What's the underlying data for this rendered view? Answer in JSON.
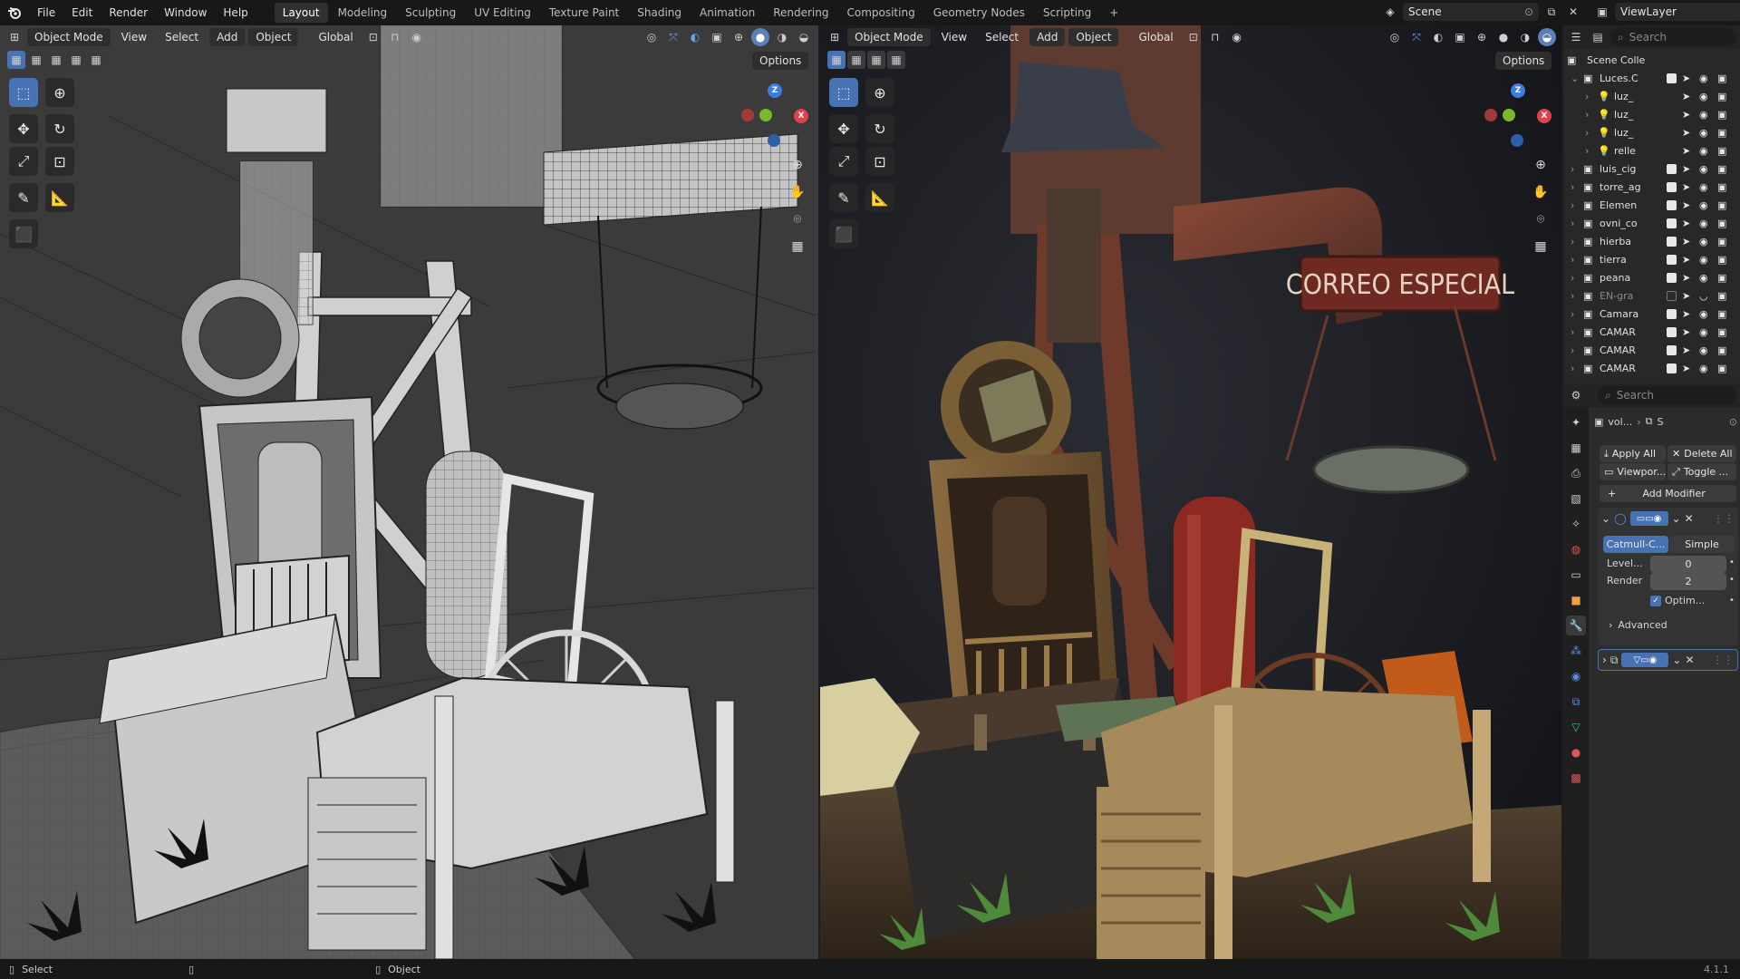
{
  "topbar": {
    "menus": [
      "File",
      "Edit",
      "Render",
      "Window",
      "Help"
    ],
    "workspaces": [
      "Layout",
      "Modeling",
      "Sculpting",
      "UV Editing",
      "Texture Paint",
      "Shading",
      "Animation",
      "Rendering",
      "Compositing",
      "Geometry Nodes",
      "Scripting"
    ],
    "active_workspace": "Layout",
    "add_workspace": "+",
    "scene": "Scene",
    "view_layer": "ViewLayer"
  },
  "viewport_header": {
    "mode": "Object Mode",
    "menus": [
      "View",
      "Select",
      "Add",
      "Object"
    ],
    "orientation": "Global",
    "options": "Options"
  },
  "left_viewport": {
    "shading": "wireframe",
    "accent": "#4772b3"
  },
  "right_viewport": {
    "shading": "rendered",
    "sign_text": "CORREO ESPECIAL"
  },
  "outliner": {
    "search_placeholder": "Search",
    "root": "Scene Colle",
    "rows": [
      {
        "label": "Luces.C",
        "indent": 1,
        "expanded": true,
        "checked": true,
        "kind": "collection"
      },
      {
        "label": "luz_",
        "indent": 2,
        "checked": null,
        "kind": "light"
      },
      {
        "label": "luz_",
        "indent": 2,
        "checked": null,
        "kind": "light"
      },
      {
        "label": "luz_",
        "indent": 2,
        "checked": null,
        "kind": "light"
      },
      {
        "label": "relle",
        "indent": 2,
        "checked": null,
        "kind": "light"
      },
      {
        "label": "luis_cig",
        "indent": 1,
        "checked": true,
        "kind": "collection"
      },
      {
        "label": "torre_ag",
        "indent": 1,
        "checked": true,
        "kind": "collection"
      },
      {
        "label": "Elemen",
        "indent": 1,
        "checked": true,
        "kind": "collection"
      },
      {
        "label": "ovni_co",
        "indent": 1,
        "checked": true,
        "kind": "collection"
      },
      {
        "label": "hierba",
        "indent": 1,
        "checked": true,
        "kind": "collection"
      },
      {
        "label": "tierra",
        "indent": 1,
        "checked": true,
        "kind": "collection"
      },
      {
        "label": "peana",
        "indent": 1,
        "checked": true,
        "kind": "collection"
      },
      {
        "label": "EN-gra",
        "indent": 1,
        "checked": false,
        "kind": "collection"
      },
      {
        "label": "Camara",
        "indent": 1,
        "checked": true,
        "kind": "collection"
      },
      {
        "label": "CAMAR",
        "indent": 1,
        "checked": true,
        "kind": "collection"
      },
      {
        "label": "CAMAR",
        "indent": 1,
        "checked": true,
        "kind": "collection"
      },
      {
        "label": "CAMAR",
        "indent": 1,
        "checked": true,
        "kind": "collection"
      }
    ]
  },
  "properties": {
    "search_placeholder": "Search",
    "object_name": "vol...",
    "breadcrumb_extra": "S",
    "apply_all": "Apply All",
    "delete_all": "Delete All",
    "viewport_btn": "Viewpor...",
    "toggle_btn": "Toggle ...",
    "add_modifier": "Add Modifier",
    "subdiv_types": [
      "Catmull-C...",
      "Simple"
    ],
    "levels_label": "Level...",
    "levels_value": "0",
    "render_label": "Render",
    "render_value": "2",
    "optimal_label": "Optim...",
    "advanced": "Advanced"
  },
  "statusbar": {
    "select": "Select",
    "object": "Object",
    "version": "4.1.1"
  }
}
